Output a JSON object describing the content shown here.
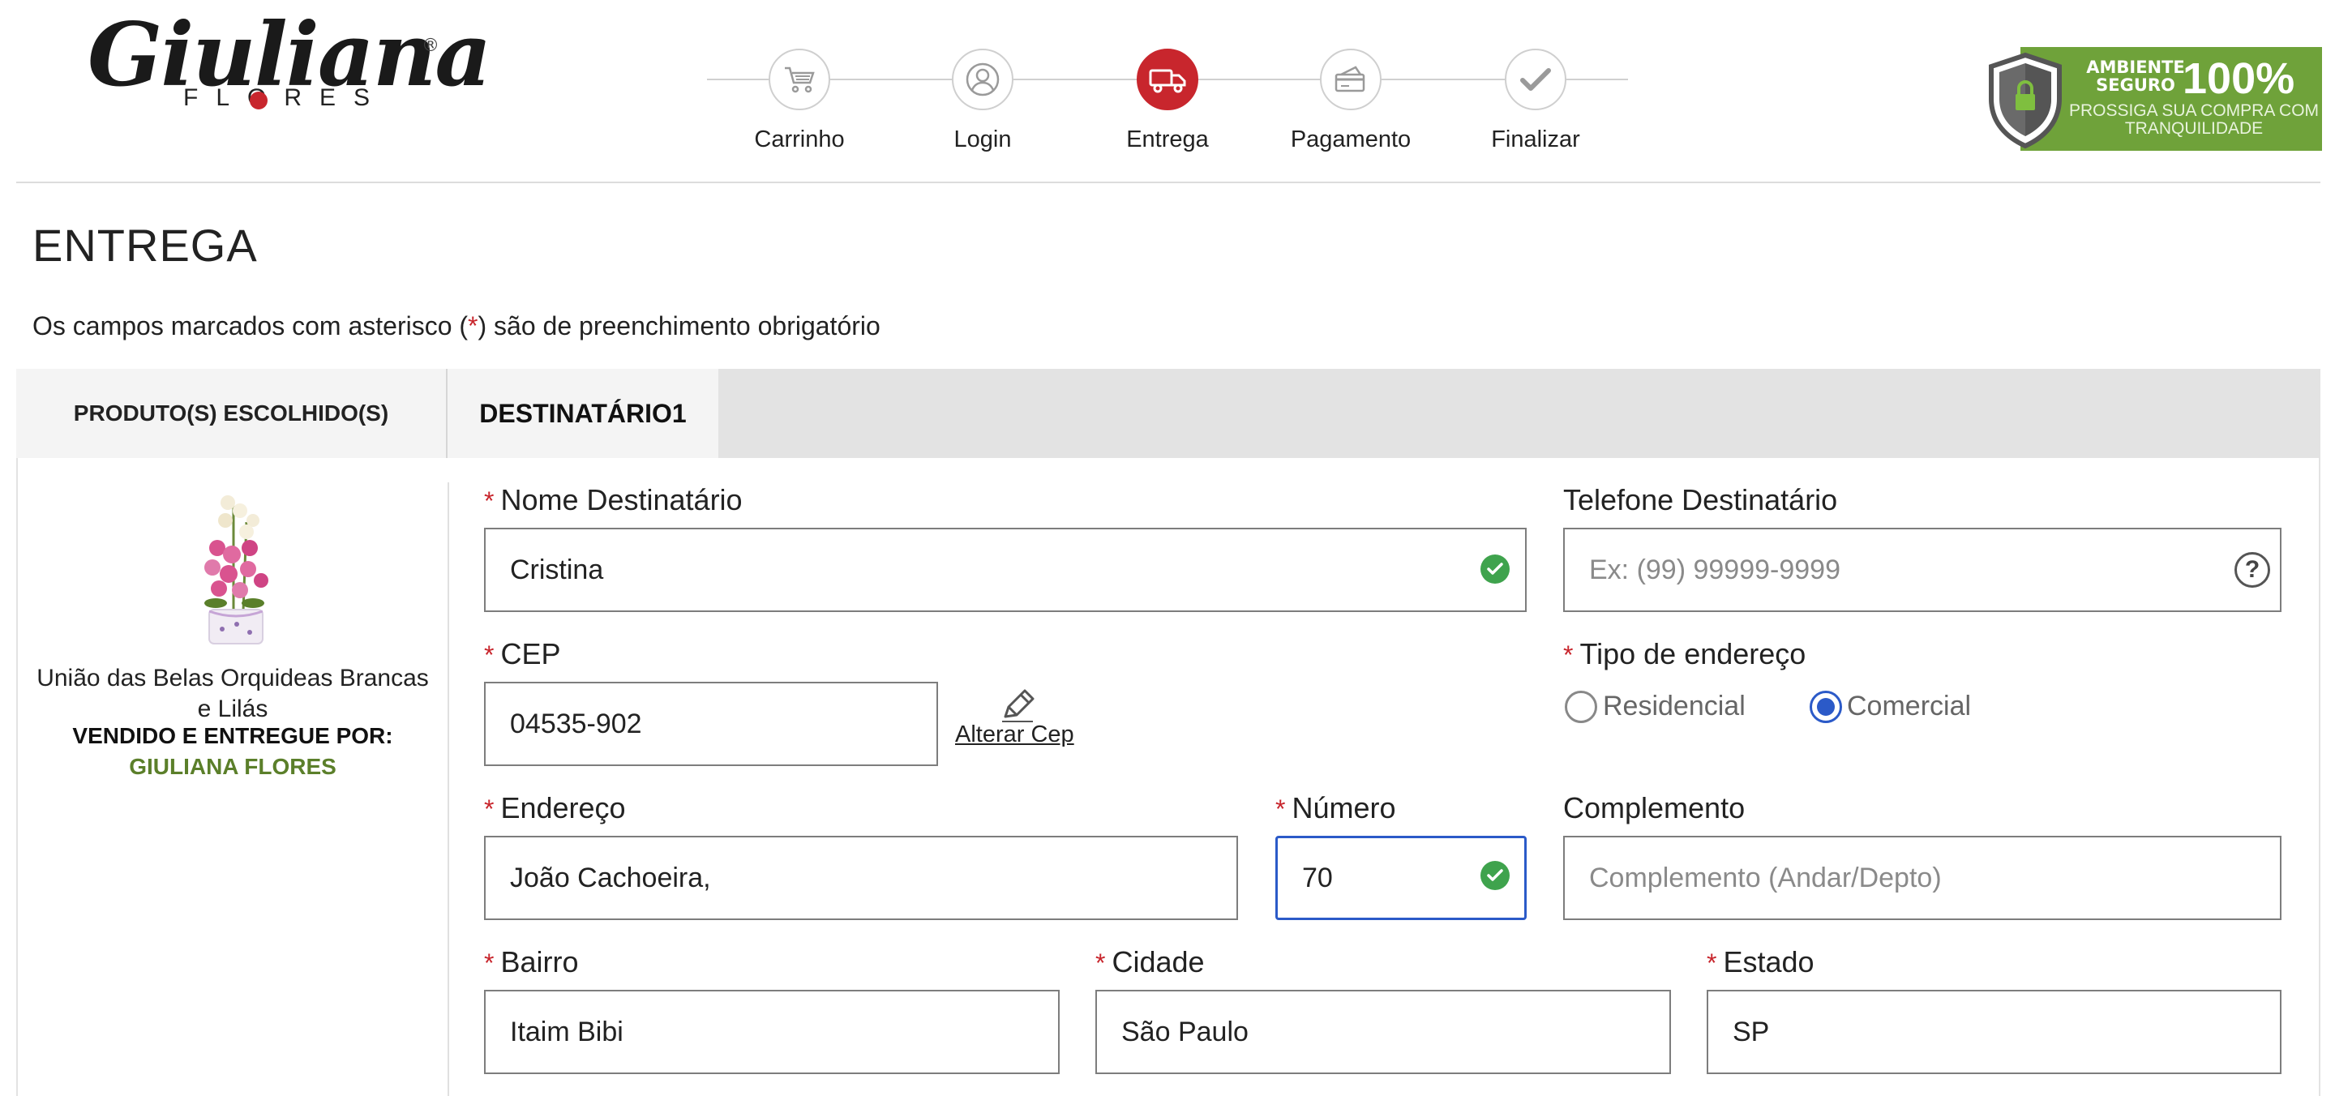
{
  "header": {
    "logo": {
      "name": "Giuliana",
      "registered": "®",
      "sub": "FLORES"
    },
    "steps": [
      {
        "label": "Carrinho",
        "icon": "cart-icon",
        "active": false
      },
      {
        "label": "Login",
        "icon": "user-icon",
        "active": false
      },
      {
        "label": "Entrega",
        "icon": "truck-icon",
        "active": true
      },
      {
        "label": "Pagamento",
        "icon": "credit-card-icon",
        "active": false
      },
      {
        "label": "Finalizar",
        "icon": "check-icon",
        "active": false
      }
    ],
    "secure_badge": {
      "line1": "AMBIENTE SEGURO",
      "percent": "100%",
      "line2": "PROSSIGA SUA COMPRA COM TRANQUILIDADE",
      "icon": "shield-lock-icon",
      "color": "#6fa23a"
    }
  },
  "page": {
    "title": "ENTREGA",
    "required_note_before": "Os campos marcados com asterisco (",
    "required_star": "*",
    "required_note_after": ") são de preenchimento obrigatório"
  },
  "tabs": [
    {
      "label": "PRODUTO(S) ESCOLHIDO(S)"
    },
    {
      "label": "DESTINATÁRIO1"
    }
  ],
  "product": {
    "name": "União das Belas Orquideas Brancas e Lilás",
    "seller_label": "VENDIDO E ENTREGUE POR:",
    "seller": "GIULIANA FLORES"
  },
  "form": {
    "required_mark": "*",
    "nome": {
      "label": "Nome Destinatário",
      "value": "Cristina",
      "valid": true
    },
    "telefone": {
      "label": "Telefone Destinatário",
      "placeholder": "Ex: (99) 99999-9999"
    },
    "cep": {
      "label": "CEP",
      "value": "04535-902",
      "alterar": "Alterar Cep"
    },
    "tipo": {
      "label": "Tipo de endereço",
      "options": [
        "Residencial",
        "Comercial"
      ],
      "selected": "Comercial"
    },
    "endereco": {
      "label": "Endereço",
      "value": "João Cachoeira,"
    },
    "numero": {
      "label": "Número",
      "value": "70",
      "valid": true
    },
    "complemento": {
      "label": "Complemento",
      "placeholder": "Complemento (Andar/Depto)"
    },
    "bairro": {
      "label": "Bairro",
      "value": "Itaim Bibi"
    },
    "cidade": {
      "label": "Cidade",
      "value": "São Paulo"
    },
    "estado": {
      "label": "Estado",
      "value": "SP"
    }
  },
  "colors": {
    "brand_red": "#c8262d",
    "valid_green": "#3fa34d",
    "focus_blue": "#2b5ac8",
    "seller_green": "#5b7f2a"
  }
}
